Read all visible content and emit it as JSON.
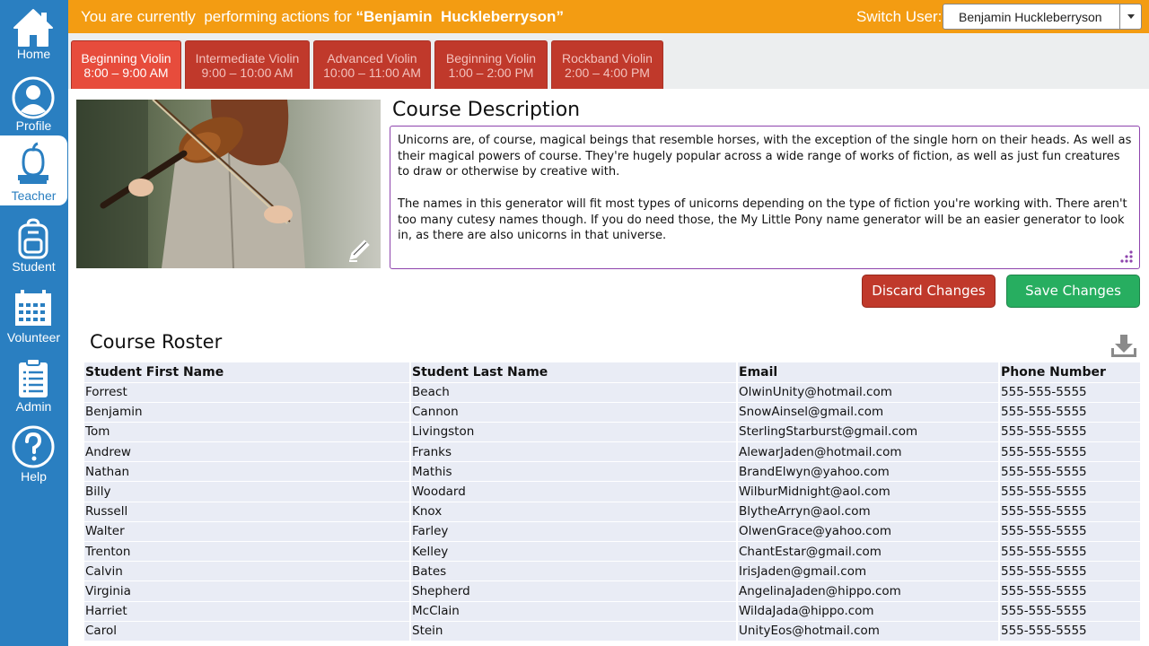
{
  "sidebar": {
    "items": [
      {
        "label": "Home",
        "icon": "home-icon"
      },
      {
        "label": "Profile",
        "icon": "profile-icon"
      },
      {
        "label": "Teacher",
        "icon": "teacher-icon",
        "active": true
      },
      {
        "label": "Student",
        "icon": "backpack-icon"
      },
      {
        "label": "Volunteer",
        "icon": "calendar-icon"
      },
      {
        "label": "Admin",
        "icon": "clipboard-icon"
      },
      {
        "label": "Help",
        "icon": "help-icon"
      }
    ]
  },
  "topbar": {
    "acting_prefix": "You are currently  performing actions for",
    "acting_user": "“Benjamin  Huckleberryson”",
    "switch_label": "Switch User:",
    "selected_user": "Benjamin Huckleberryson"
  },
  "tabs": [
    {
      "name": "Beginning Violin",
      "time": "8:00 – 9:00 AM",
      "active": true
    },
    {
      "name": "Intermediate Violin",
      "time": "9:00 – 10:00 AM"
    },
    {
      "name": "Advanced Violin",
      "time": "10:00 – 11:00 AM"
    },
    {
      "name": "Beginning Violin",
      "time": "1:00 – 2:00 PM"
    },
    {
      "name": "Rockband Violin",
      "time": "2:00 – 4:00 PM"
    }
  ],
  "description": {
    "title": "Course Description",
    "paragraphs": [
      "Unicorns are, of course, magical beings that resemble horses, with the exception of the single horn on their heads. As well as their magical powers of course. They're hugely popular across a wide range of works of fiction, as well as just fun creatures to draw or otherwise by creative with.",
      "The names in this generator will fit most types of unicorns depending on the type of fiction you're working with. There aren't too many cutesy names though. If you do need those, the My Little Pony name generator will be an easier generator to look in, as there are also unicorns in that universe."
    ]
  },
  "actions": {
    "discard_label": "Discard Changes",
    "save_label": "Save Changes"
  },
  "roster": {
    "title": "Course Roster",
    "columns": [
      "Student First Name",
      "Student Last Name",
      "Email",
      "Phone Number"
    ],
    "rows": [
      [
        "Forrest",
        "Beach",
        "OlwinUnity@hotmail.com",
        "555-555-5555"
      ],
      [
        "Benjamin",
        "Cannon",
        "SnowAinsel@gmail.com",
        "555-555-5555"
      ],
      [
        "Tom",
        "Livingston",
        "SterlingStarburst@gmail.com",
        "555-555-5555"
      ],
      [
        "Andrew",
        "Franks",
        "AlewarJaden@hotmail.com",
        "555-555-5555"
      ],
      [
        "Nathan",
        "Mathis",
        "BrandElwyn@yahoo.com",
        "555-555-5555"
      ],
      [
        "Billy",
        "Woodard",
        "WilburMidnight@aol.com",
        "555-555-5555"
      ],
      [
        "Russell",
        "Knox",
        "BlytheArryn@aol.com",
        "555-555-5555"
      ],
      [
        "Walter",
        "Farley",
        "OlwenGrace@yahoo.com",
        "555-555-5555"
      ],
      [
        "Trenton",
        "Kelley",
        "ChantEstar@gmail.com",
        "555-555-5555"
      ],
      [
        "Calvin",
        "Bates",
        "IrisJaden@gmail.com",
        "555-555-5555"
      ],
      [
        "Virginia",
        "Shepherd",
        "AngelinaJaden@hippo.com",
        "555-555-5555"
      ],
      [
        "Harriet",
        "McClain",
        "WildaJada@hippo.com",
        "555-555-5555"
      ],
      [
        "Carol",
        "Stein",
        "UnityEos@hotmail.com",
        "555-555-5555"
      ]
    ]
  },
  "colors": {
    "sidebar": "#2a7fc1",
    "topbar": "#f39c12",
    "tab": "#c0392b",
    "tab_active": "#e74c3c",
    "discard": "#c0392b",
    "save": "#27ae60"
  }
}
